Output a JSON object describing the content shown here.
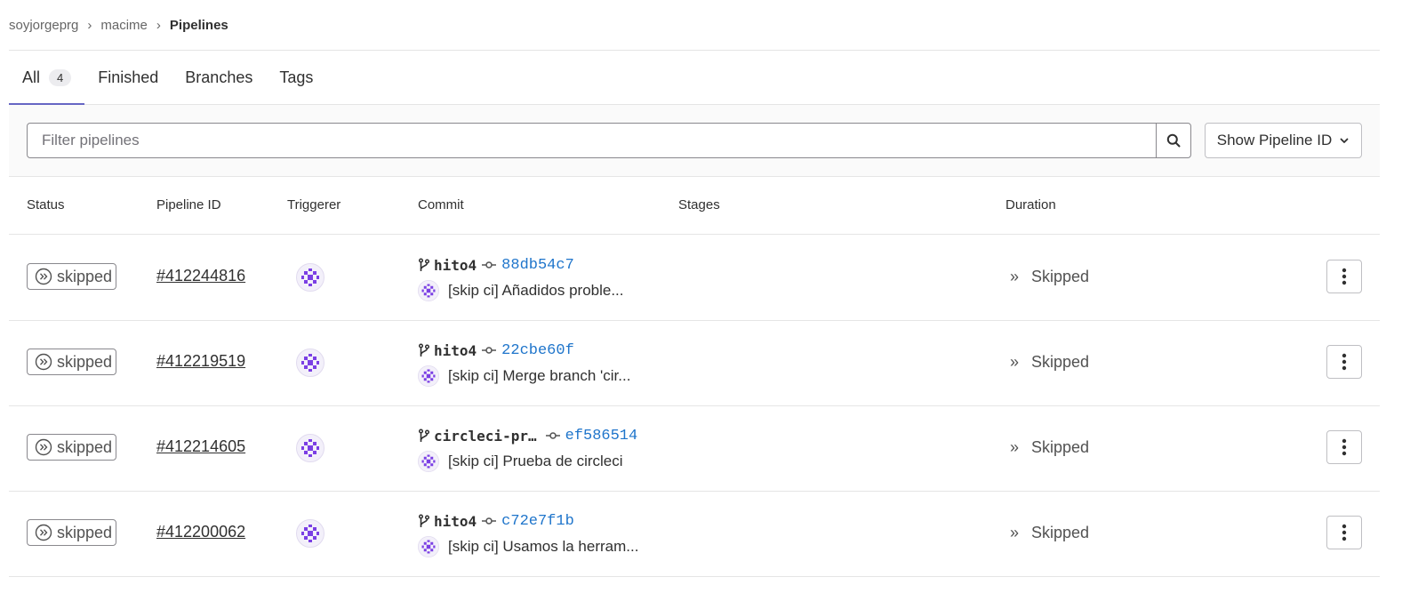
{
  "breadcrumb": {
    "items": [
      {
        "label": "soyjorgeprg"
      },
      {
        "label": "macime"
      },
      {
        "label": "Pipelines"
      }
    ],
    "separator": "›"
  },
  "tabs": [
    {
      "label": "All",
      "count": "4"
    },
    {
      "label": "Finished"
    },
    {
      "label": "Branches"
    },
    {
      "label": "Tags"
    }
  ],
  "filter": {
    "placeholder": "Filter pipelines",
    "value": "",
    "show_id_label": "Show Pipeline ID"
  },
  "table": {
    "headers": {
      "status": "Status",
      "pipeline_id": "Pipeline ID",
      "triggerer": "Triggerer",
      "commit": "Commit",
      "stages": "Stages",
      "duration": "Duration"
    },
    "rows": [
      {
        "status": "skipped",
        "id": "#412244816",
        "branch": "hito4",
        "sha": "88db54c7",
        "message": "[skip ci] Añadidos proble...",
        "duration": "Skipped"
      },
      {
        "status": "skipped",
        "id": "#412219519",
        "branch": "hito4",
        "sha": "22cbe60f",
        "message": "[skip ci] Merge branch 'cir...",
        "duration": "Skipped"
      },
      {
        "status": "skipped",
        "id": "#412214605",
        "branch": "circleci-pr…",
        "sha": "ef586514",
        "message": "[skip ci] Prueba de circleci",
        "duration": "Skipped"
      },
      {
        "status": "skipped",
        "id": "#412200062",
        "branch": "hito4",
        "sha": "c72e7f1b",
        "message": "[skip ci] Usamos la herram...",
        "duration": "Skipped"
      }
    ]
  },
  "colors": {
    "accent": "#6666c4",
    "link": "#1f75cb",
    "avatar": "#7b3fe4"
  },
  "icons": {
    "search": "search-icon",
    "chevron": "chevron-down-icon",
    "skipped": "status-skipped-icon",
    "branch": "branch-icon",
    "commit": "commit-icon",
    "duration": "double-chevron-right-icon",
    "kebab": "ellipsis-v-icon"
  }
}
